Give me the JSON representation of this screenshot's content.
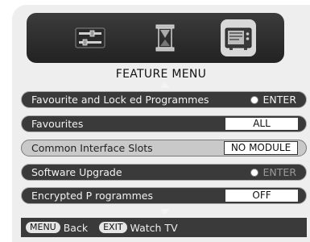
{
  "tabs": [
    {
      "icon": "settings-sliders-icon"
    },
    {
      "icon": "hourglass-icon"
    },
    {
      "icon": "tv-icon",
      "selected": true
    }
  ],
  "menu_title": "FEATURE MENU",
  "items": [
    {
      "label": "Favourite and Lock  ed Programmes",
      "control": "ENTER"
    },
    {
      "label": "Favourites",
      "value": "ALL"
    },
    {
      "label": "Common Interface Slots",
      "value": "NO MODULE"
    },
    {
      "label": "Software Upgrade",
      "control": "ENTER"
    },
    {
      "label": "Encrypted P rogrammes",
      "value": "OFF"
    }
  ],
  "footer": {
    "back_key": "MENU",
    "back_label": "Back",
    "exit_key": "EXIT",
    "exit_label": "Watch TV"
  },
  "colors": {
    "row_dark": "#3a3a3a",
    "row_highlight": "#c9c9c9",
    "panel": "#eeeeee"
  }
}
